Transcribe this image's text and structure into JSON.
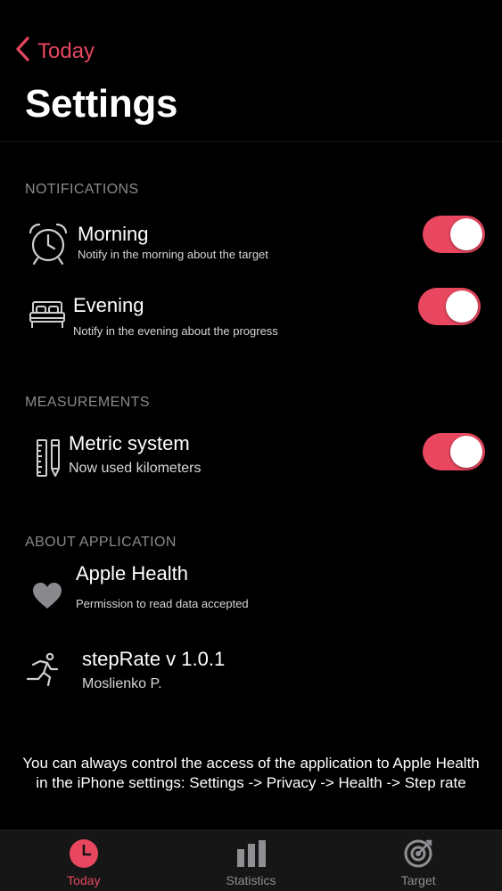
{
  "nav": {
    "back_label": "Today",
    "title": "Settings"
  },
  "colors": {
    "accent": "#e8475f",
    "background": "#000000",
    "secondary_text": "#8a8a8e"
  },
  "sections": {
    "notifications": {
      "header": "NOTIFICATIONS",
      "morning": {
        "icon": "alarm-clock-icon",
        "title": "Morning",
        "subtitle": "Notify in the morning about the target",
        "enabled": true
      },
      "evening": {
        "icon": "bed-icon",
        "title": "Evening",
        "subtitle": "Notify in the evening about the progress",
        "enabled": true
      }
    },
    "measurements": {
      "header": "MEASUREMENTS",
      "metric": {
        "icon": "ruler-pencil-icon",
        "title": "Metric system",
        "subtitle": "Now used kilometers",
        "enabled": true
      }
    },
    "about": {
      "header": "ABOUT APPLICATION",
      "health": {
        "icon": "heart-icon",
        "title": "Apple Health",
        "subtitle": "Permission to read data accepted"
      },
      "app": {
        "icon": "runner-icon",
        "title": "stepRate v 1.0.1",
        "subtitle": "Moslienko P."
      }
    }
  },
  "footer_note": {
    "line1": "You can always control the access of the application to Apple Health",
    "line2": "in the iPhone settings: Settings -> Privacy -> Health -> Step rate"
  },
  "tabbar": {
    "active": "Today",
    "tabs": [
      {
        "label": "Today",
        "icon": "clock-icon"
      },
      {
        "label": "Statistics",
        "icon": "bar-chart-icon"
      },
      {
        "label": "Target",
        "icon": "target-icon"
      }
    ]
  }
}
